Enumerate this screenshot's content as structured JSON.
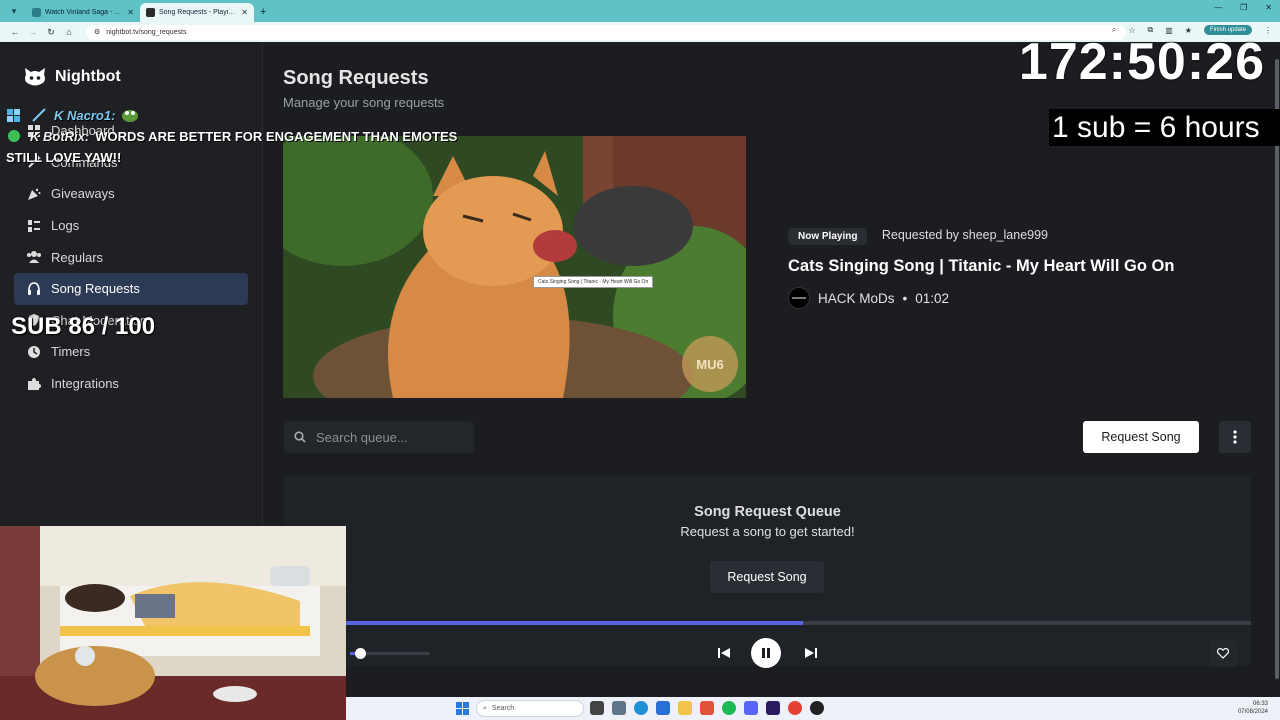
{
  "browser": {
    "tabs": [
      {
        "title": "Watch Vinland Saga - Miruro",
        "active": false
      },
      {
        "title": "Song Requests - Playing Ca...",
        "active": true
      }
    ],
    "url": "nightbot.tv/song_requests",
    "finish_update_label": "Finish update"
  },
  "sidebar": {
    "brand": "Nightbot",
    "items": [
      {
        "label": "Dashboard",
        "icon": "dashboard-icon"
      },
      {
        "label": "Commands",
        "icon": "wand-icon"
      },
      {
        "label": "Giveaways",
        "icon": "party-icon"
      },
      {
        "label": "Logs",
        "icon": "list-icon"
      },
      {
        "label": "Regulars",
        "icon": "users-icon"
      },
      {
        "label": "Song Requests",
        "icon": "headphones-icon",
        "active": true
      },
      {
        "label": "Chat Moderation",
        "icon": "shield-icon"
      },
      {
        "label": "Timers",
        "icon": "clock-icon"
      },
      {
        "label": "Integrations",
        "icon": "puzzle-icon"
      }
    ]
  },
  "main": {
    "title": "Song Requests",
    "subtitle": "Manage your song requests",
    "video_tooltip": "Cats Singing Song | Titanic - My Heart Will Go On",
    "video_watermark": "MU6",
    "now_playing": {
      "badge": "Now Playing",
      "requested_by": "Requested by sheep_lane999",
      "title": "Cats Singing Song | Titanic - My Heart Will Go On",
      "channel": "HACK MoDs",
      "separator": "•",
      "duration": "01:02"
    },
    "search_placeholder": "Search queue...",
    "request_button": "Request Song",
    "queue": {
      "title": "Song Request Queue",
      "subtitle": "Request a song to get started!",
      "button": "Request Song"
    },
    "player": {
      "progress_percent": 50.5,
      "volume_percent": 13
    }
  },
  "overlay": {
    "timer": "172:50:26",
    "sub_rate": "1 sub = 6 hours",
    "sub_goal": "SUB 86 / 100",
    "chat": [
      {
        "name": "K Nacro1:",
        "message": "",
        "name_color": "#7ec8f0"
      },
      {
        "name": "K BotRix:",
        "message": "WORDS ARE BETTER FOR ENGAGEMENT THAN EMOTES",
        "name_color": "#f0f0f0"
      },
      {
        "name": "",
        "message": "STILL LOVE YAW!!",
        "name_color": "#ffffff"
      }
    ]
  },
  "taskbar": {
    "search_placeholder": "Search",
    "time": "06:33",
    "date": "07/08/2024"
  }
}
